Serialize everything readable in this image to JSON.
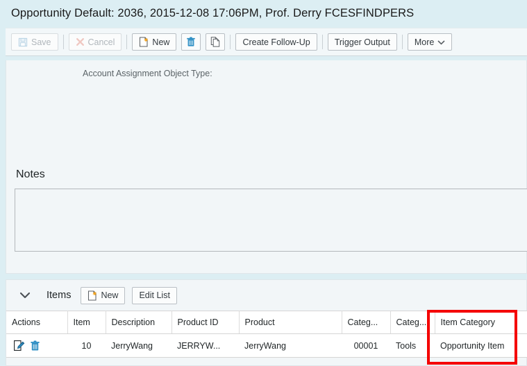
{
  "window": {
    "title": "Opportunity Default: 2036, 2015-12-08 17:06PM, Prof. Derry FCESFINDPERS"
  },
  "toolbar": {
    "save_label": "Save",
    "cancel_label": "Cancel",
    "new_label": "New",
    "delete_icon_name": "trash-icon",
    "copy_icon_name": "copy-icon",
    "create_follow_up_label": "Create Follow-Up",
    "trigger_output_label": "Trigger Output",
    "more_label": "More"
  },
  "main": {
    "account_assignment_object_type_label": "Account Assignment Object Type:",
    "notes_title": "Notes",
    "notes_value": "",
    "notes_placeholder": ""
  },
  "items": {
    "section_label": "Items",
    "new_label": "New",
    "edit_list_label": "Edit List",
    "columns": [
      "Actions",
      "Item",
      "Description",
      "Product ID",
      "Product",
      "Categ...",
      "Categ...",
      "Item Category"
    ],
    "rows": [
      {
        "item": "10",
        "description": "JerryWang",
        "product_id": "JERRYW...",
        "product": "JerryWang",
        "category1": "00001",
        "category2": "Tools",
        "item_category": "Opportunity Item"
      }
    ]
  },
  "annotation": {
    "highlight_color": "#f40000",
    "highlight_target": "item-category-column"
  },
  "colors": {
    "title_bar": "#dceef3",
    "panel": "#f2f6f8",
    "link": "#2a73b8",
    "table_bg": "#ffffff"
  }
}
